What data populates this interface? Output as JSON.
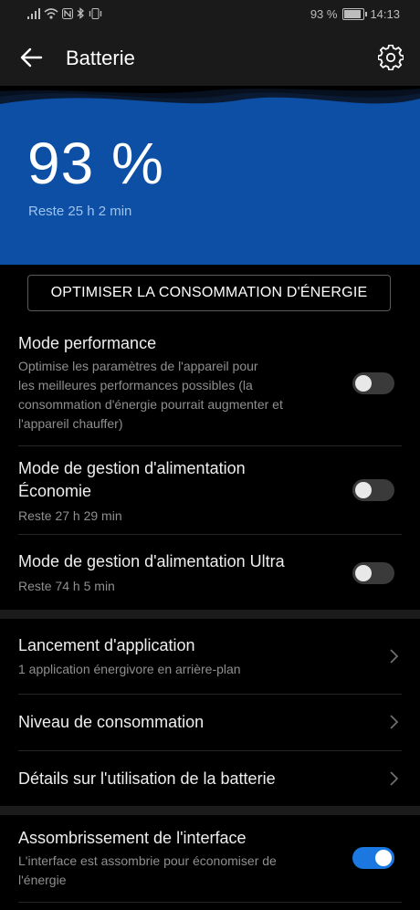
{
  "status_bar": {
    "battery_text": "93 %",
    "time": "14:13",
    "battery_level": 0.93
  },
  "app_bar": {
    "title": "Batterie"
  },
  "hero": {
    "percentage": "93 %",
    "remaining": "Reste 25 h 2 min"
  },
  "optimize_button": "OPTIMISER LA CONSOMMATION D'ÉNERGIE",
  "settings": {
    "performance": {
      "title": "Mode performance",
      "subtitle_lines": [
        "Optimise les paramètres de l'appareil pour",
        "les meilleures performances possibles (la",
        "consommation d'énergie pourrait augmenter et",
        "l'appareil chauffer)"
      ],
      "enabled": false
    },
    "economy": {
      "title_line1": "Mode de gestion d'alimentation",
      "title_line2": "Économie",
      "subtitle": "Reste 27 h 29 min",
      "enabled": false
    },
    "ultra": {
      "title": "Mode de gestion d'alimentation Ultra",
      "subtitle": "Reste 74 h 5 min",
      "enabled": false
    }
  },
  "nav_items": {
    "app_launch": {
      "title": "Lancement d'application",
      "subtitle": "1 application énergivore en arrière-plan"
    },
    "consumption_level": {
      "title": "Niveau de consommation"
    },
    "usage_details": {
      "title": "Détails sur l'utilisation de la batterie"
    }
  },
  "dark_interface": {
    "title": "Assombrissement de l'interface",
    "subtitle_lines": [
      "L'interface est assombrie pour économiser de",
      "l'énergie"
    ],
    "enabled": true
  },
  "colors": {
    "hero_blue": "#0c4fa4",
    "toggle_on": "#1a78e0",
    "background": "#000000"
  }
}
